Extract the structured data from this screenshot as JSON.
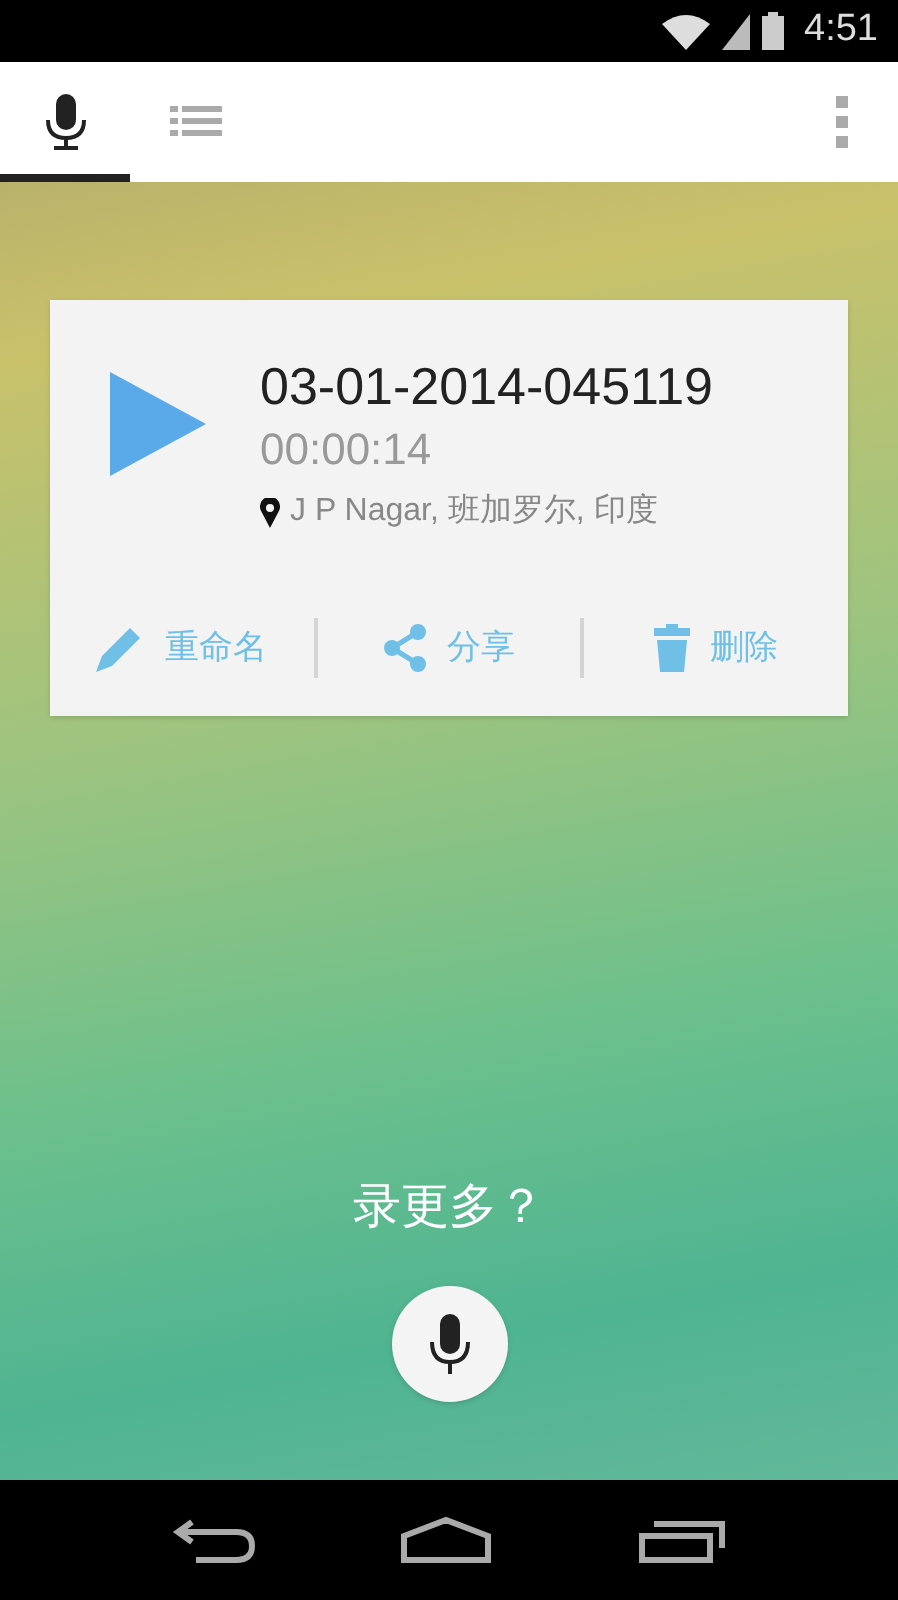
{
  "status_bar": {
    "time": "4:51"
  },
  "tabs": [
    {
      "kind": "record",
      "selected": true
    },
    {
      "kind": "list",
      "selected": false
    }
  ],
  "recording": {
    "title": "03-01-2014-045119",
    "duration": "00:00:14",
    "location": "J P Nagar, 班加罗尔, 印度"
  },
  "actions": [
    {
      "kind": "rename",
      "label": "重命名"
    },
    {
      "kind": "share",
      "label": "分享"
    },
    {
      "kind": "delete",
      "label": "删除"
    }
  ],
  "prompt": "录更多？"
}
